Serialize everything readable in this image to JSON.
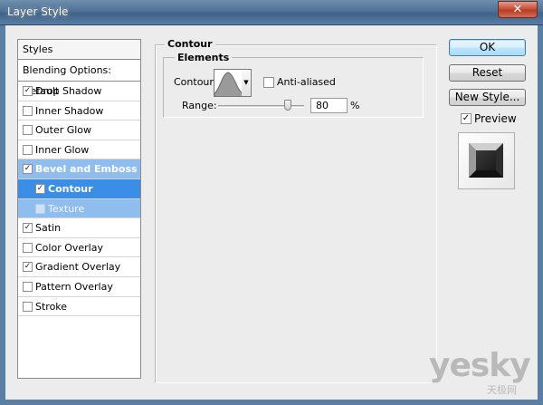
{
  "window": {
    "title": "Layer Style",
    "close_icon": "close-icon"
  },
  "styles_panel": {
    "header": "Styles",
    "blending": "Blending Options: Default",
    "items": [
      {
        "label": "Drop Shadow",
        "checked": true
      },
      {
        "label": "Inner Shadow",
        "checked": false
      },
      {
        "label": "Outer Glow",
        "checked": false
      },
      {
        "label": "Inner Glow",
        "checked": false
      },
      {
        "label": "Bevel and Emboss",
        "checked": true,
        "state": "parent-selected"
      },
      {
        "label": "Contour",
        "checked": true,
        "state": "selected"
      },
      {
        "label": "Texture",
        "checked": false,
        "state": "child"
      },
      {
        "label": "Satin",
        "checked": true
      },
      {
        "label": "Color Overlay",
        "checked": false
      },
      {
        "label": "Gradient Overlay",
        "checked": true
      },
      {
        "label": "Pattern Overlay",
        "checked": false
      },
      {
        "label": "Stroke",
        "checked": false
      }
    ],
    "colors": {
      "selected": "#3b8ee6",
      "parent_selected": "#8fbdee"
    }
  },
  "contour_panel": {
    "group_title": "Contour",
    "elements_title": "Elements",
    "contour_label": "Contour:",
    "anti_aliased_label": "Anti-aliased",
    "anti_aliased_checked": false,
    "range_label": "Range:",
    "range_value": "80",
    "range_unit": "%",
    "range_fraction": 0.8
  },
  "buttons": {
    "ok": "OK",
    "reset": "Reset",
    "new_style": "New Style..."
  },
  "preview": {
    "label": "Preview",
    "checked": true
  },
  "watermark": {
    "text": "yesky",
    "subtext": "天极网"
  }
}
